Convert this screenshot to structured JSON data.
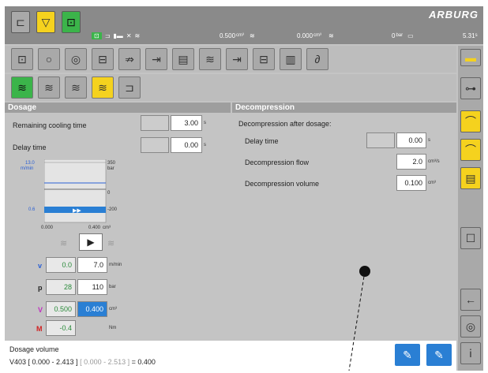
{
  "header": {
    "logo": "ARBURG",
    "status_injection": "0.500",
    "status_injection_unit": "cm³",
    "status_dosage": "0.000",
    "status_dosage_unit": "cm³",
    "status_pressure": "0",
    "status_pressure_unit": "bar",
    "status_time": "5.31",
    "status_time_unit": "s"
  },
  "dosage": {
    "title": "Dosage",
    "remaining_cooling_label": "Remaining cooling time",
    "remaining_cooling_value": "3.00",
    "remaining_cooling_unit": "s",
    "delay_label": "Delay time",
    "delay_value": "0.00",
    "delay_unit": "s",
    "chart": {
      "y_top_left": "13.0",
      "y_top_left_unit": "m/min",
      "y_top_right": "350",
      "y_top_right_unit": "bar",
      "y_mid_right": "0",
      "y_bot_left": "0.6",
      "y_bot_right": "-200",
      "x_left": "0.000",
      "x_right": "0.400",
      "x_unit": "cm³"
    },
    "rows": [
      {
        "label": "v",
        "actual": "0.0",
        "set": "7.0",
        "unit": "m/min",
        "color": "#2a5fd4"
      },
      {
        "label": "p",
        "actual": "28",
        "set": "110",
        "unit": "bar",
        "color": "#222222"
      },
      {
        "label": "V",
        "actual": "0.500",
        "set": "0.400",
        "unit": "cm³",
        "color": "#c030c0"
      },
      {
        "label": "M",
        "actual": "-0.4",
        "set": "",
        "unit": "Nm",
        "color": "#d02020"
      }
    ]
  },
  "decompression": {
    "title": "Decompression",
    "after_dosage_label": "Decompression after dosage:",
    "delay_label": "Delay time",
    "delay_value": "0.00",
    "delay_unit": "s",
    "flow_label": "Decompression flow",
    "flow_value": "2.0",
    "flow_unit": "cm³/s",
    "volume_label": "Decompression volume",
    "volume_value": "0.100",
    "volume_unit": "cm³"
  },
  "footer": {
    "title": "Dosage volume",
    "line_prefix": "V403 [ 0.000 - 2.413 ]",
    "line_range": "[ 0.000 - 2.513 ]",
    "line_value": "= 0.400"
  }
}
